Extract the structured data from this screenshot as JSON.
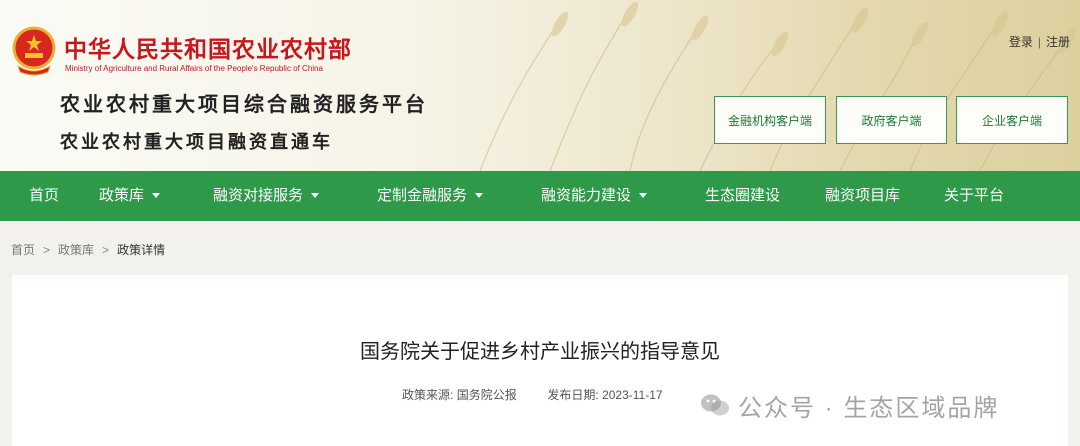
{
  "header": {
    "ministry_cn": "中华人民共和国农业农村部",
    "ministry_en": "Ministry of Agriculture and Rural Affairs of the People's Republic of China",
    "platform_title": "农业农村重大项目综合融资服务平台",
    "platform_subtitle": "农业农村重大项目融资直通车",
    "login": "登录",
    "separator": "|",
    "register": "注册",
    "clients": [
      "金融机构客户端",
      "政府客户端",
      "企业客户端"
    ]
  },
  "nav": {
    "items": [
      "首页",
      "政策库",
      "融资对接服务",
      "定制金融服务",
      "融资能力建设",
      "生态圈建设",
      "融资项目库",
      "关于平台"
    ]
  },
  "breadcrumb": {
    "home": "首页",
    "sep": ">",
    "level1": "政策库",
    "current": "政策详情"
  },
  "article": {
    "title": "国务院关于促进乡村产业振兴的指导意见",
    "source_label": "政策来源:",
    "source": "国务院公报",
    "date_label": "发布日期:",
    "date": "2023-11-17"
  },
  "watermark": {
    "text": "公众号 · 生态区域品牌"
  },
  "colors": {
    "nav_green": "#2e9948",
    "ministry_red": "#c8161d",
    "client_border": "#3a9a54"
  }
}
